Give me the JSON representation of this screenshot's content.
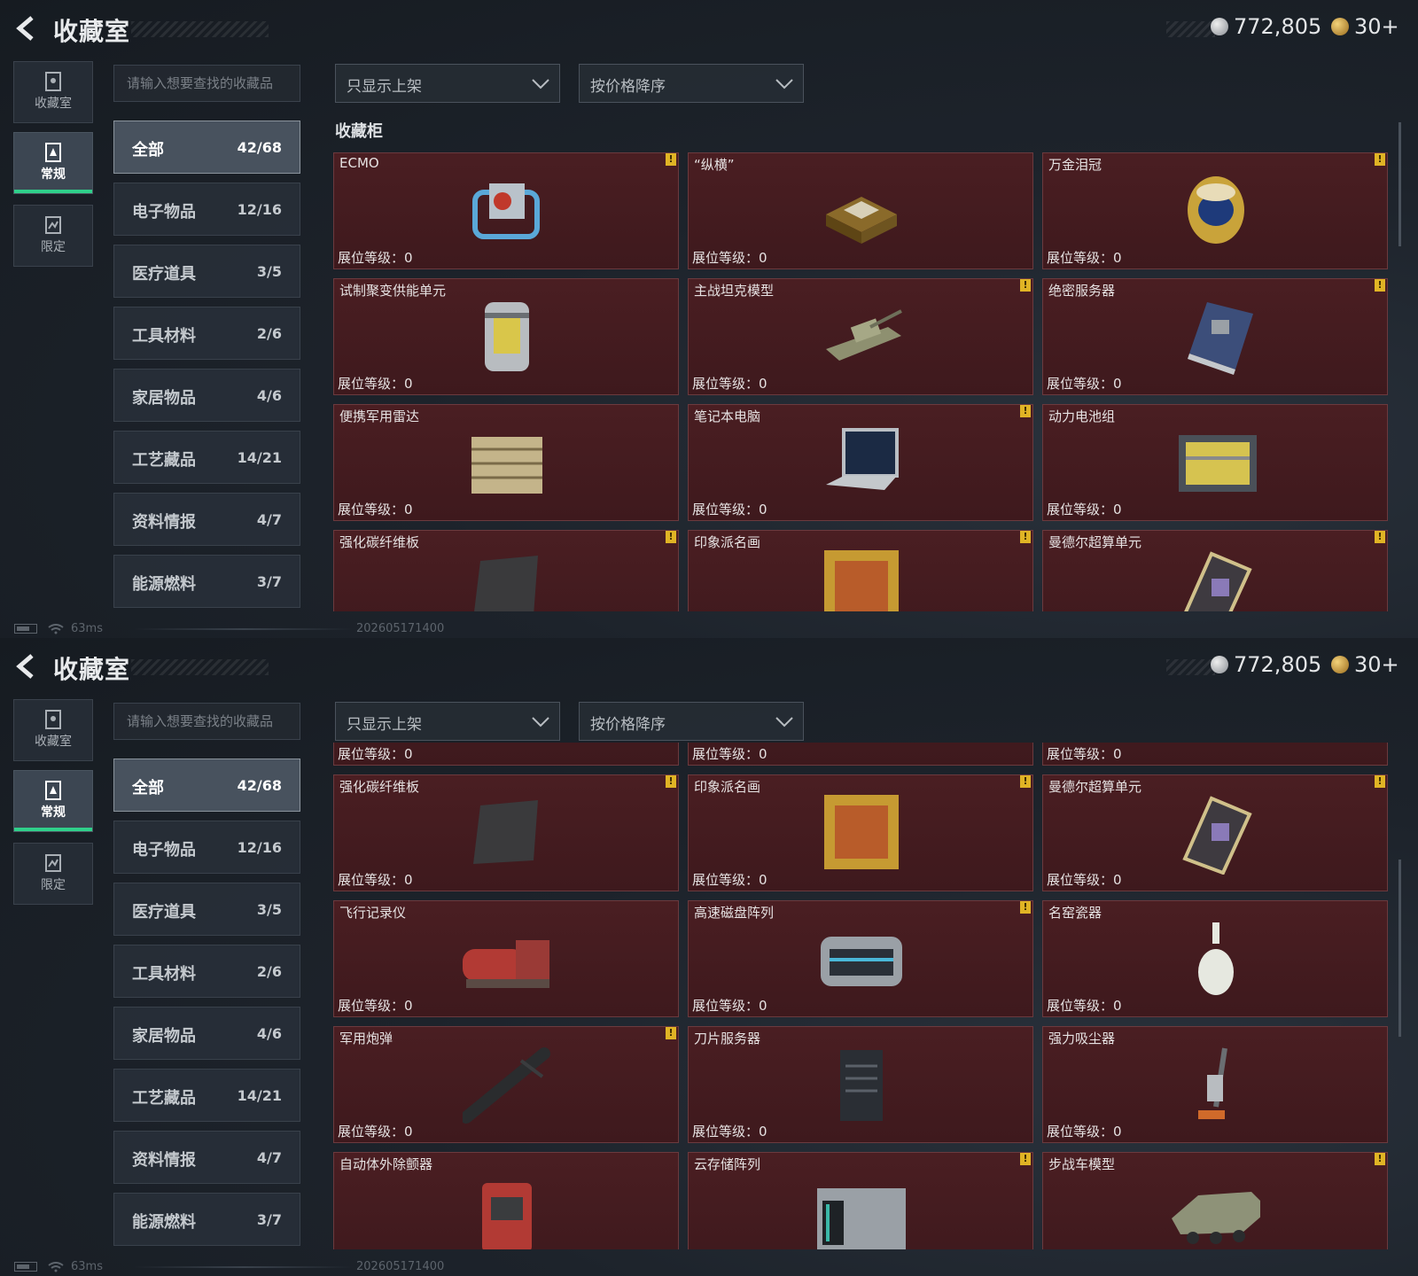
{
  "header": {
    "title": "收藏室",
    "currency1": "772,805",
    "currency2": "30+"
  },
  "nav": [
    {
      "label": "收藏室",
      "icon": "collection-room-icon"
    },
    {
      "label": "常规",
      "icon": "regular-icon"
    },
    {
      "label": "限定",
      "icon": "limited-icon"
    }
  ],
  "search": {
    "placeholder": "请输入想要查找的收藏品"
  },
  "filters": {
    "shelf": "只显示上架",
    "sort": "按价格降序"
  },
  "categories": [
    {
      "label": "全部",
      "count": "42/68"
    },
    {
      "label": "电子物品",
      "count": "12/16"
    },
    {
      "label": "医疗道具",
      "count": "3/5"
    },
    {
      "label": "工具材料",
      "count": "2/6"
    },
    {
      "label": "家居物品",
      "count": "4/6"
    },
    {
      "label": "工艺藏品",
      "count": "14/21"
    },
    {
      "label": "资料情报",
      "count": "4/7"
    },
    {
      "label": "能源燃料",
      "count": "3/7"
    }
  ],
  "section_title": "收藏柜",
  "level_label": "展位等级：0",
  "alert_mark": "!",
  "screen1_items": [
    {
      "name": "ECMO",
      "alert": true
    },
    {
      "name": "“纵横”",
      "alert": false
    },
    {
      "name": "万金泪冠",
      "alert": true
    },
    {
      "name": "试制聚变供能单元",
      "alert": false
    },
    {
      "name": "主战坦克模型",
      "alert": true
    },
    {
      "name": "绝密服务器",
      "alert": true
    },
    {
      "name": "便携军用雷达",
      "alert": false
    },
    {
      "name": "笔记本电脑",
      "alert": true
    },
    {
      "name": "动力电池组",
      "alert": false
    },
    {
      "name": "强化碳纤维板",
      "alert": true
    },
    {
      "name": "印象派名画",
      "alert": true
    },
    {
      "name": "曼德尔超算单元",
      "alert": true
    }
  ],
  "screen2_items": [
    {
      "name": "强化碳纤维板",
      "alert": true
    },
    {
      "name": "印象派名画",
      "alert": true
    },
    {
      "name": "曼德尔超算单元",
      "alert": true
    },
    {
      "name": "飞行记录仪",
      "alert": false
    },
    {
      "name": "高速磁盘阵列",
      "alert": true
    },
    {
      "name": "名窑瓷器",
      "alert": false
    },
    {
      "name": "军用炮弹",
      "alert": true
    },
    {
      "name": "刀片服务器",
      "alert": false
    },
    {
      "name": "强力吸尘器",
      "alert": false
    },
    {
      "name": "自动体外除颤器",
      "alert": false
    },
    {
      "name": "云存储阵列",
      "alert": true
    },
    {
      "name": "步战车模型",
      "alert": true
    }
  ],
  "status": {
    "latency": "63ms",
    "version": "202605171400"
  },
  "colors": {
    "accent": "#2fd08a",
    "card_bg": "#4a1e22",
    "card_border": "#6b3a3e",
    "alert": "#e0b425"
  }
}
